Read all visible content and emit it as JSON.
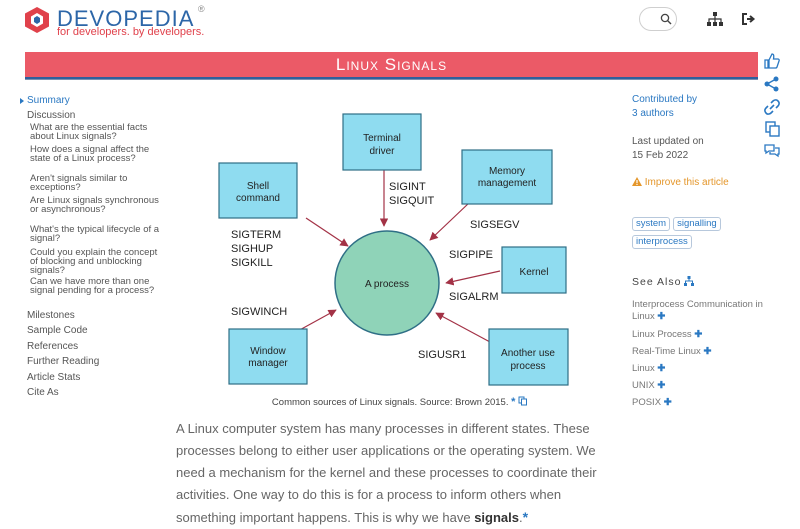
{
  "header": {
    "brand": "DEVOPEDIA",
    "registered": "®",
    "tagline": "for developers. by developers."
  },
  "page": {
    "title": "Linux Signals"
  },
  "toc": {
    "summary": "Summary",
    "discussion": "Discussion",
    "questions": [
      "What are the essential facts about Linux signals?",
      "How does a signal affect the state of a Linux process?",
      "Aren't signals similar to exceptions?",
      "Are Linux signals synchronous or asynchronous?",
      "What's the typical lifecycle of a signal?",
      "Could you explain the concept of blocking and unblocking signals?",
      "Can we have more than one signal pending for a process?"
    ],
    "sections": [
      "Milestones",
      "Sample Code",
      "References",
      "Further Reading",
      "Article Stats",
      "Cite As"
    ]
  },
  "diagram": {
    "center": "A process",
    "sources": [
      {
        "name": "Terminal driver",
        "signals": "SIGINT\nSIGQUIT"
      },
      {
        "name": "Memory management",
        "signals": "SIGSEGV"
      },
      {
        "name": "Shell command",
        "signals": "SIGTERM\nSIGHUP\nSIGKILL"
      },
      {
        "name": "Kernel",
        "signals": "SIGPIPE\nSIGALRM"
      },
      {
        "name": "Window manager",
        "signals": "SIGWINCH"
      },
      {
        "name": "Another use process",
        "signals": "SIGUSR1"
      }
    ],
    "caption": "Common sources of Linux signals. Source: Brown 2015."
  },
  "article": {
    "text": "A Linux computer system has many processes in different states. These processes belong to either user applications or the operating system. We need a mechanism for the kernel and these processes to coordinate their activities. One way to do this is for a process to inform others when something important happens. This is why we have ",
    "bold": "signals",
    "end": "."
  },
  "sidebar_right": {
    "contributed_by": "Contributed by",
    "authors": "3 authors",
    "last_updated_label": "Last updated on",
    "last_updated": "15 Feb 2022",
    "improve": "Improve this article",
    "tags": [
      "system",
      "signalling",
      "interprocess"
    ],
    "see_also_title": "See Also",
    "see_also": [
      "Interprocess Communication in Linux",
      "Linux Process",
      "Real-Time Linux",
      "Linux",
      "UNIX",
      "POSIX"
    ]
  },
  "colors": {
    "brand_blue": "#2c66a8",
    "brand_red": "#e0414b",
    "title_bar": "#eb5a67",
    "box_fill": "#8fdcf0",
    "process_fill": "#8fd3b8",
    "link": "#2a78c2",
    "improve": "#e4962a"
  },
  "icons": [
    "hexagon-logo-icon",
    "search-icon",
    "sitemap-icon",
    "login-icon",
    "thumbs-up-icon",
    "share-icon",
    "link-icon",
    "copy-icon",
    "comments-icon",
    "warning-icon",
    "plus-icon"
  ]
}
